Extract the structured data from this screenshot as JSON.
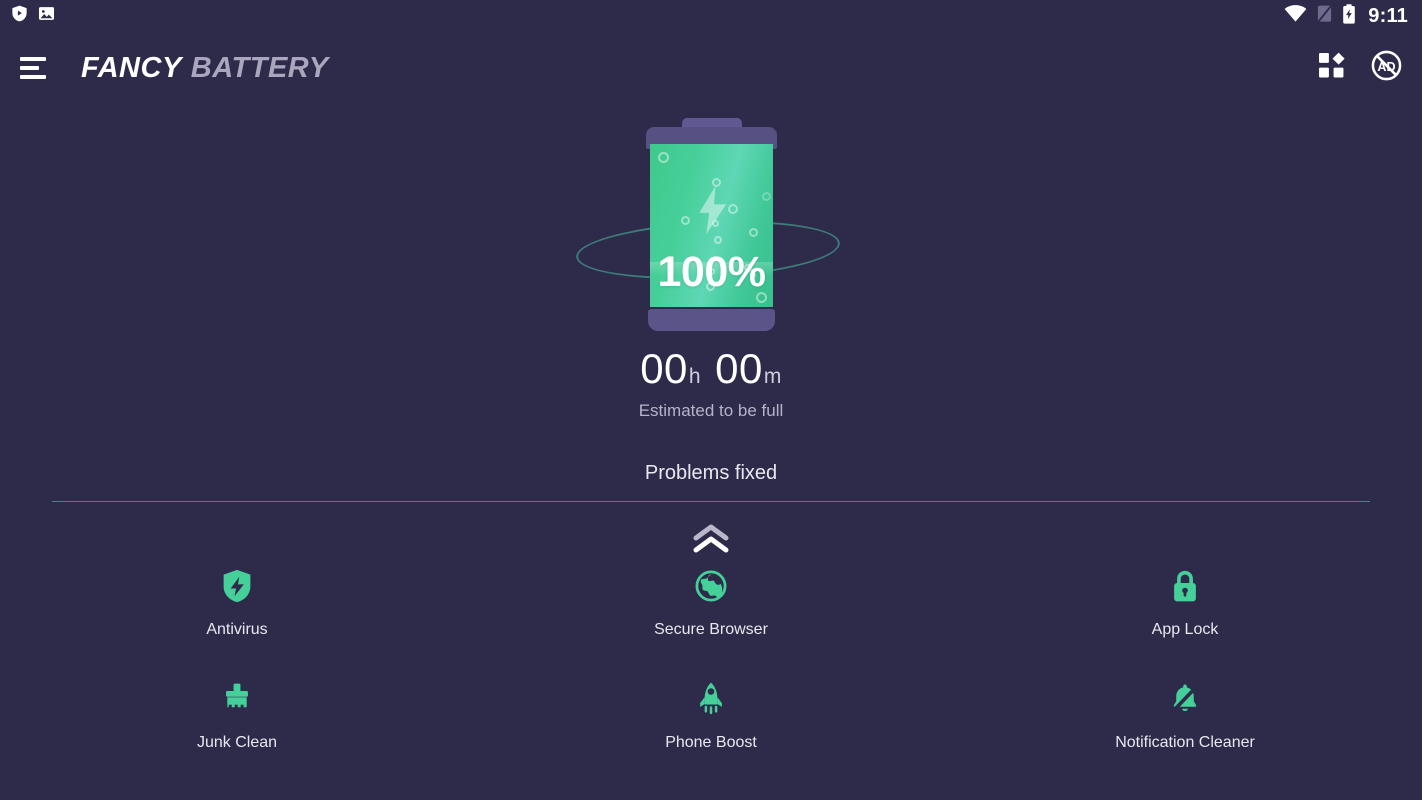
{
  "status_bar": {
    "notification_icons": [
      "play-protect-icon",
      "image-icon"
    ],
    "wifi_icon": "wifi-icon",
    "signal_icon": "no-signal-icon",
    "battery_icon": "battery-charging-icon",
    "time": "9:11"
  },
  "app_bar": {
    "menu_icon": "hamburger-menu-icon",
    "brand_primary": "FANCY",
    "brand_secondary": "BATTERY",
    "apps_icon": "apps-grid-icon",
    "remove_ads_icon": "no-ads-icon"
  },
  "battery": {
    "percent_label": "100%",
    "fill_percent": 100,
    "charging": true,
    "fill_color": "#45cf99",
    "shell_color": "#565083",
    "orbit_color": "#3d7b79"
  },
  "estimate": {
    "hours": "00",
    "hours_unit": "h",
    "minutes": "00",
    "minutes_unit": "m",
    "caption": "Estimated to be full"
  },
  "status_message": {
    "text": "Problems fixed",
    "divider_color": "#4e7f84",
    "expand_icon": "double-chevron-up-icon"
  },
  "features": [
    {
      "id": "antivirus",
      "label": "Antivirus",
      "icon": "shield-bolt-icon",
      "color": "#45cf99"
    },
    {
      "id": "secure-browser",
      "label": "Secure Browser",
      "icon": "globe-icon",
      "color": "#45cf99"
    },
    {
      "id": "app-lock",
      "label": "App Lock",
      "icon": "lock-icon",
      "color": "#45cf99"
    },
    {
      "id": "junk-clean",
      "label": "Junk Clean",
      "icon": "broom-icon",
      "color": "#45cf99"
    },
    {
      "id": "phone-boost",
      "label": "Phone Boost",
      "icon": "rocket-icon",
      "color": "#45cf99"
    },
    {
      "id": "notification-cleaner",
      "label": "Notification Cleaner",
      "icon": "bell-slash-icon",
      "color": "#45cf99"
    }
  ],
  "theme": {
    "background": "#2e2b4a",
    "accent": "#45cf99",
    "text_primary": "#ffffff",
    "text_secondary": "#b6b3c8"
  }
}
